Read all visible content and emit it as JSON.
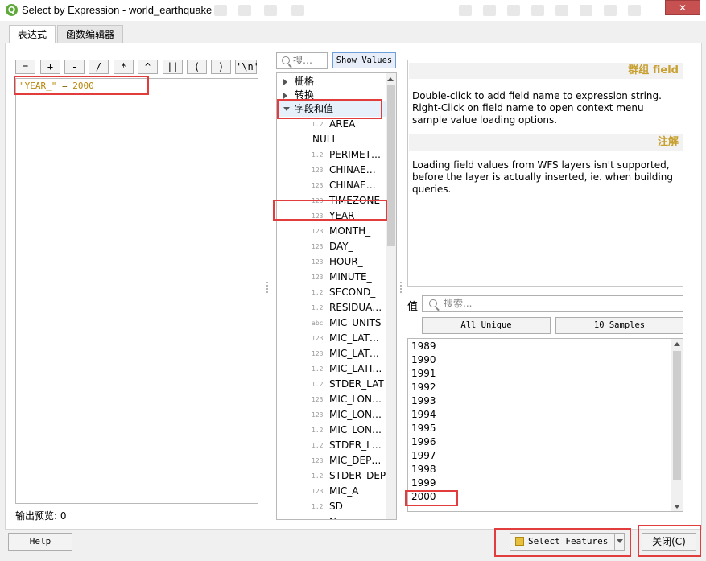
{
  "window": {
    "title": "Select by Expression - world_earthquake",
    "close_symbol": "✕"
  },
  "tabs": [
    {
      "label": "表达式",
      "active": true
    },
    {
      "label": "函数编辑器",
      "active": false
    }
  ],
  "operators": [
    "=",
    "+",
    "-",
    "/",
    "*",
    "^",
    "||",
    "(",
    ")",
    "'\\n'"
  ],
  "expression": {
    "field": "\"YEAR_\"",
    "operator": " = ",
    "value": "2000"
  },
  "preview": {
    "label": "输出预览:",
    "value": "0"
  },
  "function_search": {
    "placeholder": "搜…"
  },
  "show_values_label": "Show Values",
  "tree": {
    "groups": [
      {
        "label": "栅格",
        "expanded": false
      },
      {
        "label": "转换",
        "expanded": false
      },
      {
        "label": "字段和值",
        "expanded": true
      }
    ],
    "fields": [
      {
        "type": "1.2",
        "name": "AREA"
      },
      {
        "type": "",
        "name": "NULL"
      },
      {
        "type": "1.2",
        "name": "PERIMET…"
      },
      {
        "type": "123",
        "name": "CHINAE…"
      },
      {
        "type": "123",
        "name": "CHINAE…"
      },
      {
        "type": "123",
        "name": "TIMEZONE"
      },
      {
        "type": "123",
        "name": "YEAR_"
      },
      {
        "type": "123",
        "name": "MONTH_"
      },
      {
        "type": "123",
        "name": "DAY_"
      },
      {
        "type": "123",
        "name": "HOUR_"
      },
      {
        "type": "123",
        "name": "MINUTE_"
      },
      {
        "type": "1.2",
        "name": "SECOND_"
      },
      {
        "type": "1.2",
        "name": "RESIDUA…"
      },
      {
        "type": "abc",
        "name": "MIC_UNITS"
      },
      {
        "type": "123",
        "name": "MIC_LAT…"
      },
      {
        "type": "123",
        "name": "MIC_LAT…"
      },
      {
        "type": "1.2",
        "name": "MIC_LATI…"
      },
      {
        "type": "1.2",
        "name": "STDER_LAT"
      },
      {
        "type": "123",
        "name": "MIC_LON…"
      },
      {
        "type": "123",
        "name": "MIC_LON…"
      },
      {
        "type": "1.2",
        "name": "MIC_LON…"
      },
      {
        "type": "1.2",
        "name": "STDER_L…"
      },
      {
        "type": "123",
        "name": "MIC_DEP…"
      },
      {
        "type": "1.2",
        "name": "STDER_DEP"
      },
      {
        "type": "123",
        "name": "MIC_A"
      },
      {
        "type": "1.2",
        "name": "SD"
      },
      {
        "type": "123",
        "name": "N"
      }
    ]
  },
  "help": {
    "group_title": "群组 field",
    "description": "Double-click to add field name to expression string.\nRight-Click on field name to open context menu sample value loading options.",
    "notes_title": "注解",
    "notes": "Loading field values from WFS layers isn't supported, before the layer is actually inserted, ie. when building queries."
  },
  "values": {
    "label": "值",
    "search_placeholder": "搜索...",
    "all_unique_label": "All Unique",
    "samples_label": "10 Samples",
    "items": [
      "1989",
      "1990",
      "1991",
      "1992",
      "1993",
      "1994",
      "1995",
      "1996",
      "1997",
      "1998",
      "1999",
      "2000"
    ]
  },
  "buttons": {
    "help": "Help",
    "select_features": "Select Features",
    "close": "关闭(C)"
  },
  "colors": {
    "highlight": "#e33c3c",
    "accent": "#c8a030",
    "expression_text": "#b8860b"
  }
}
